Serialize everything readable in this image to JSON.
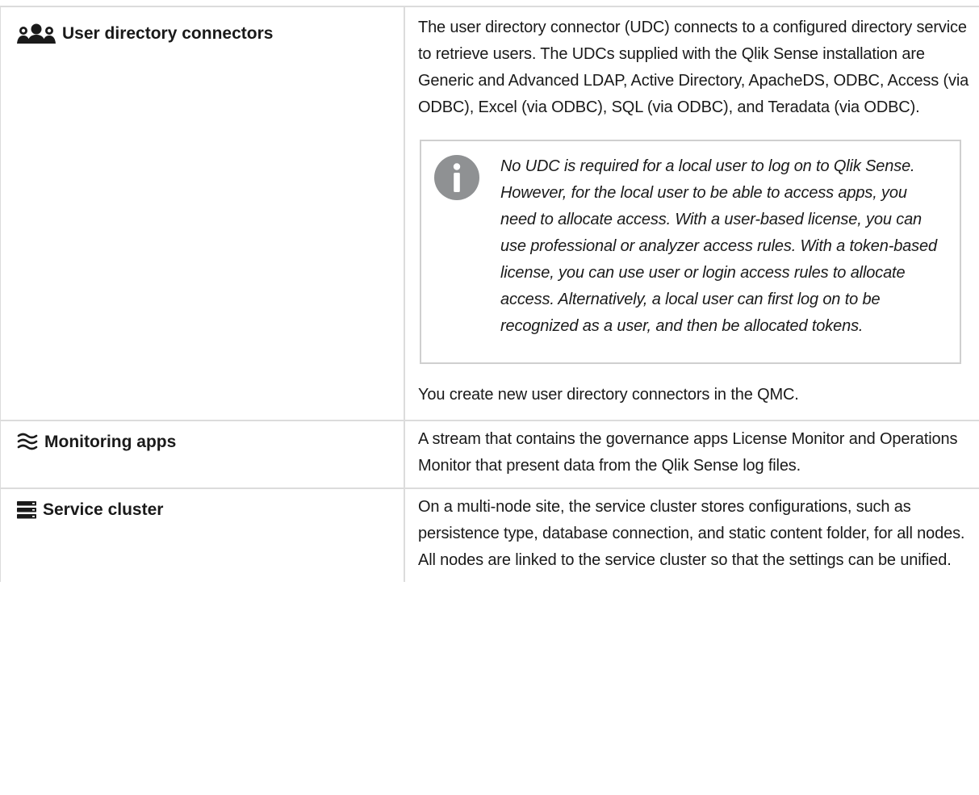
{
  "rows": [
    {
      "icon": "users-icon",
      "term": "User directory connectors",
      "description": "The user directory connector (UDC) connects to a configured directory service to retrieve users. The UDCs supplied with the Qlik Sense installation are Generic and Advanced LDAP, Active Directory, ApacheDS, ODBC, Access (via ODBC), Excel (via ODBC), SQL (via ODBC), and Teradata (via ODBC).",
      "note": {
        "icon": "info-icon",
        "text": "No UDC is required for a local user to log on to Qlik Sense. However, for the local user to be able to access apps, you need to allocate access. With a user-based license, you can use professional or analyzer access rules. With a token-based license, you can use user or login access rules to allocate access. Alternatively, a local user can first log on to be recognized as a user, and then be allocated tokens."
      },
      "after_note": "You create new user directory connectors in the QMC."
    },
    {
      "icon": "waves-icon",
      "term": "Monitoring apps",
      "description": "A stream that contains the governance apps License Monitor and Operations Monitor that present data from the Qlik Sense log files."
    },
    {
      "icon": "server-stack-icon",
      "term": "Service cluster",
      "description": "On a multi-node site, the service cluster stores configurations, such as persistence type, database connection, and static content folder, for all nodes. All nodes are linked to the service cluster so that the settings can be unified."
    }
  ],
  "colors": {
    "border": "#dcdcdc",
    "note_border": "#cfcfcf",
    "info_icon": "#8f9193",
    "text": "#1a1a1a"
  }
}
